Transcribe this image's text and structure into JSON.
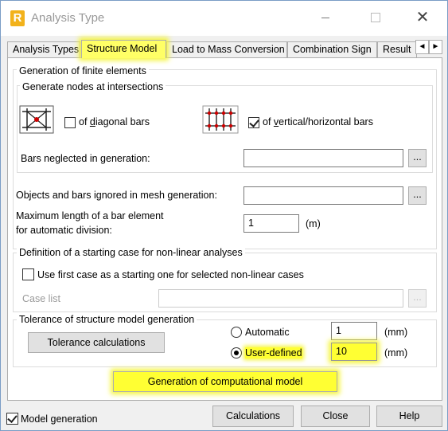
{
  "window": {
    "title": "Analysis Type",
    "app_icon_letter": "R"
  },
  "tabs": [
    {
      "label": "Analysis Types"
    },
    {
      "label": "Structure Model"
    },
    {
      "label": "Load to Mass Conversion"
    },
    {
      "label": "Combination Sign"
    },
    {
      "label": "Result"
    }
  ],
  "tab_arrows": {
    "left": "◄",
    "right": "►"
  },
  "finite_elements": {
    "title": "Generation of finite elements",
    "nodes_group": {
      "title": "Generate nodes at intersections",
      "diagonal": {
        "prefix": "of ",
        "hotkey": "d",
        "rest": "iagonal bars",
        "checked": false
      },
      "vertical": {
        "prefix": "of ",
        "hotkey": "v",
        "rest": "ertical/horizontal bars",
        "checked": true
      },
      "bars_neglected_label": "Bars neglected in generation:",
      "bars_neglected_value": "",
      "browse_label": "..."
    },
    "objects_ignored_label": "Objects and bars ignored in mesh generation:",
    "objects_ignored_value": "",
    "browse_label": "...",
    "max_length_label_1": "Maximum length of a bar element",
    "max_length_label_2": "for automatic division:",
    "max_length_value": "1",
    "max_length_unit": "(m)"
  },
  "nonlinear": {
    "title": "Definition of a starting case for non-linear analyses",
    "use_first_case_label": "Use first case as a starting one for selected non-linear cases",
    "use_first_case_checked": false,
    "case_list_label": "Case list",
    "case_list_value": "",
    "browse_label": "..."
  },
  "tolerance": {
    "title": "Tolerance of structure model generation",
    "calc_button": "Tolerance calculations",
    "automatic_label": "Automatic",
    "automatic_value": "1",
    "automatic_unit": "(mm)",
    "user_defined_label": "User-defined",
    "user_defined_value": "10",
    "user_defined_unit": "(mm)",
    "selected": "user-defined"
  },
  "generate_button": "Generation of computational model",
  "footer": {
    "model_generation_label": "Model generation",
    "model_generation_checked": true,
    "calculations": "Calculations",
    "close": "Close",
    "help": "Help"
  },
  "colors": {
    "highlight": "#ffff33",
    "intersection_dot": "#cc0000"
  }
}
